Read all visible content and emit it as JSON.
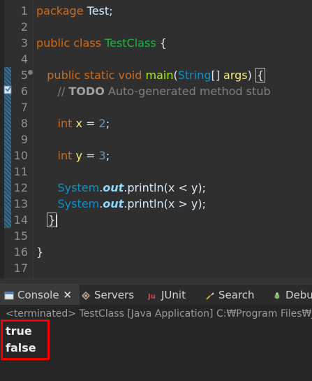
{
  "editor": {
    "line_numbers": [
      "1",
      "2",
      "3",
      "4",
      "5",
      "6",
      "7",
      "8",
      "9",
      "10",
      "11",
      "12",
      "13",
      "14",
      "15",
      "16",
      "17"
    ],
    "l1": {
      "kw": "package",
      "name": "Test;"
    },
    "l3": {
      "kw1": "public",
      "kw2": "class",
      "cls": "TestClass",
      "brace": "{"
    },
    "l5": {
      "kw1": "public",
      "kw2": "static",
      "kw3": "void",
      "fn": "main",
      "paren_open": "(",
      "type": "String",
      "arr": "[]",
      "param": "args",
      "paren_close": ")",
      "brace": "{"
    },
    "l6": {
      "slashes": "//",
      "todo": "TODO",
      "rest": "Auto-generated method stub"
    },
    "l8": {
      "kw": "int",
      "var": "x",
      "eq": "=",
      "num": "2",
      "end": ";"
    },
    "l10": {
      "kw": "int",
      "var": "y",
      "eq": "=",
      "num": "3",
      "end": ";"
    },
    "l12": {
      "cls": "System",
      "dot1": ".",
      "out": "out",
      "dot2": ".println(x < y);"
    },
    "l13": {
      "cls": "System",
      "dot1": ".",
      "out": "out",
      "dot2": ".println(x > y);"
    },
    "l14": {
      "brace": "}"
    },
    "l16": {
      "brace": "}"
    }
  },
  "tabs": {
    "console": "Console",
    "close": "✕",
    "servers": "Servers",
    "junit": "JUnit",
    "search": "Search",
    "debug": "Debu"
  },
  "console": {
    "status": "<terminated> TestClass [Java Application] C:₩Program Files₩Java",
    "output": [
      "true",
      "false"
    ]
  },
  "colors": {
    "highlight": "#ee0000",
    "keyword": "#cc6c1d",
    "method": "#a7ec21"
  }
}
